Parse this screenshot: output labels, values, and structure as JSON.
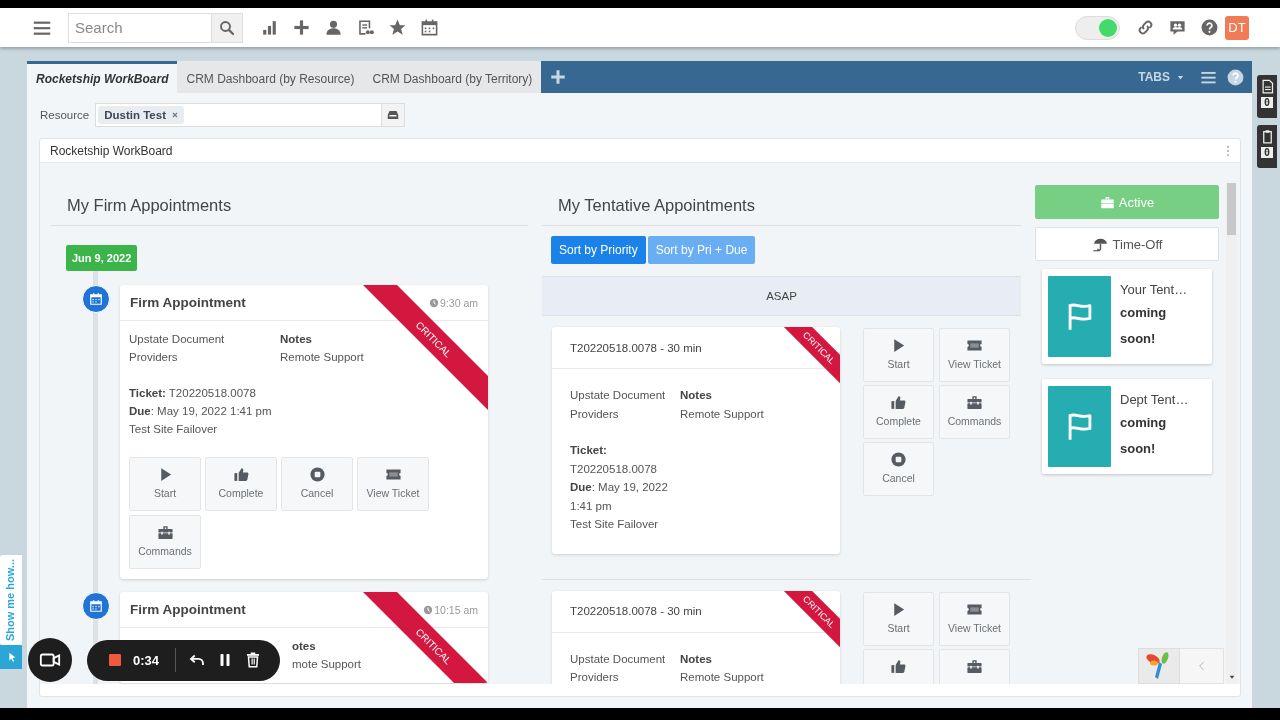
{
  "topbar": {
    "search": {
      "placeholder": "Search"
    },
    "presence": {
      "on": true
    },
    "avatar": "DT"
  },
  "tabs": [
    {
      "label": "Rocketship WorkBoard",
      "selected": true
    },
    {
      "label": "CRM Dashboard (by Resource)",
      "selected": false
    },
    {
      "label": "CRM Dashboard (by Territory)",
      "selected": false
    }
  ],
  "tab_bar": {
    "menu_label": "TABS"
  },
  "side_counters": [
    {
      "kind": "document",
      "count": "0"
    },
    {
      "kind": "clipboard",
      "count": "0"
    }
  ],
  "filter": {
    "label": "Resource",
    "tokens": [
      "Dustin Test"
    ]
  },
  "panel": {
    "title": "Rocketship WorkBoard"
  },
  "firm": {
    "heading": "My Firm Appointments",
    "date": "Jun 9, 2022",
    "appointments": [
      {
        "title": "Firm Appointment",
        "time": "9:30 am",
        "ribbon": "CRITICAL",
        "company": "Upstate Document Providers",
        "notes_label": "Notes",
        "notes": "Remote Support",
        "ticket": "**Ticket:** T20220518.0078",
        "due": "**Due**: May 19, 2022 1:41 pm",
        "description": "Test Site Failover",
        "actions": [
          {
            "kind": "start",
            "label": "Start"
          },
          {
            "kind": "complete",
            "label": "Complete"
          },
          {
            "kind": "cancel",
            "label": "Cancel"
          },
          {
            "kind": "view",
            "label": "View Ticket"
          },
          {
            "kind": "commands",
            "label": "Commands"
          }
        ]
      },
      {
        "title": "Firm Appointment",
        "time": "10:15 am",
        "ribbon": "CRITICAL",
        "notes_label": "otes",
        "notes": "mote Support"
      }
    ]
  },
  "tentative": {
    "heading": "My Tentative Appointments",
    "sort_buttons": [
      {
        "label": "Sort by Priority",
        "selected": true
      },
      {
        "label": "Sort by Pri + Due",
        "selected": false
      }
    ],
    "group": "ASAP",
    "items": [
      {
        "title": "T20220518.0078 - 30 min",
        "ribbon": "CRITICAL",
        "company": "Upstate Document Providers",
        "notes_label": "Notes",
        "notes": "Remote Support",
        "ticket": "**Ticket:** T20220518.0078",
        "due": "**Due**: May 19, 2022 1:41 pm",
        "description": "Test Site Failover",
        "actions": [
          {
            "kind": "start",
            "label": "Start"
          },
          {
            "kind": "view",
            "label": "View Ticket"
          },
          {
            "kind": "complete",
            "label": "Complete"
          },
          {
            "kind": "commands",
            "label": "Commands"
          },
          {
            "kind": "cancel",
            "label": "Cancel"
          }
        ]
      },
      {
        "title": "T20220518.0078 - 30 min",
        "ribbon": "CRITICAL",
        "company": "Upstate Document Providers",
        "notes_label": "Notes",
        "notes": "Remote Support",
        "actions": [
          {
            "kind": "start",
            "label": "Start"
          },
          {
            "kind": "view",
            "label": "View Ticket"
          },
          {
            "kind": "complete"
          },
          {
            "kind": "commands"
          }
        ]
      }
    ]
  },
  "status": [
    {
      "kind": "active",
      "label": "Active",
      "selected": true
    },
    {
      "kind": "timeoff",
      "label": "Time-Off",
      "selected": false
    }
  ],
  "widgets": [
    {
      "title": "Your Tent…",
      "text": "coming soon!"
    },
    {
      "title": "Dept Tent…",
      "text": "coming soon!"
    }
  ],
  "recorder": {
    "time": "0:34"
  },
  "help_tab": {
    "label": "Show me how..."
  }
}
